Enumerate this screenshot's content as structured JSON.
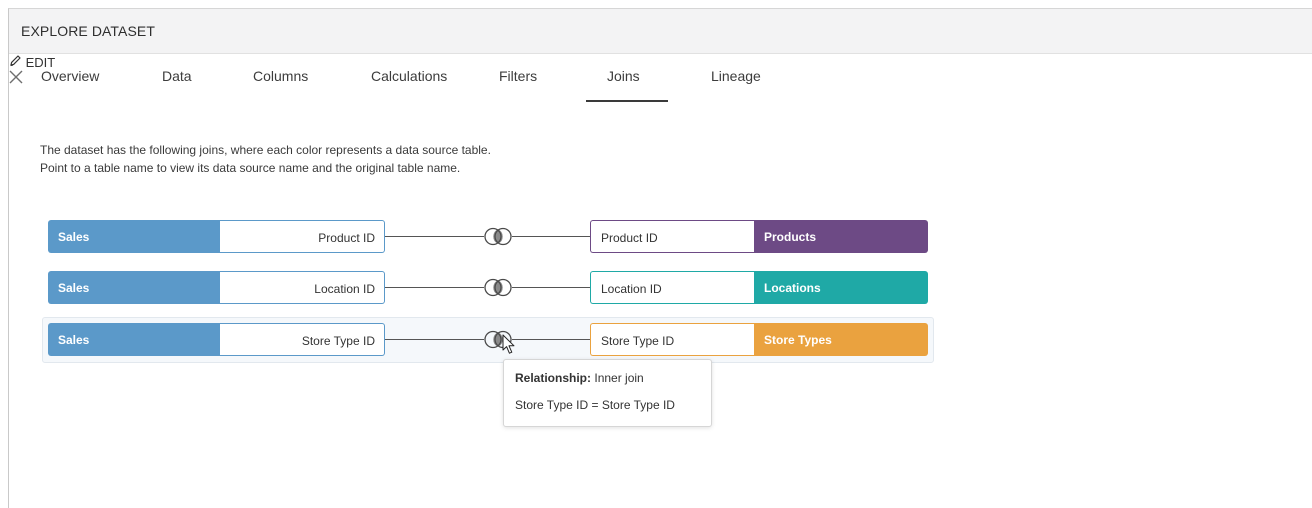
{
  "window": {
    "title": "EXPLORE DATASET",
    "edit_label": "EDIT",
    "edit_icon": "pencil-icon",
    "close_icon": "close-icon"
  },
  "tabs": [
    {
      "label": "Overview",
      "active": false
    },
    {
      "label": "Data",
      "active": false
    },
    {
      "label": "Columns",
      "active": false
    },
    {
      "label": "Calculations",
      "active": false
    },
    {
      "label": "Filters",
      "active": false
    },
    {
      "label": "Joins",
      "active": true
    },
    {
      "label": "Lineage",
      "active": false
    }
  ],
  "description": {
    "line1": "The dataset has the following joins, where each color represents a data source table.",
    "line2": "Point to a table name to view its data source name and the original table name."
  },
  "colors": {
    "sales": "#5b99c9",
    "products": "#6d4a85",
    "locations": "#1fa9a6",
    "store_types": "#eaa23f"
  },
  "joins": [
    {
      "left_table": "Sales",
      "left_column": "Product ID",
      "right_column": "Product ID",
      "right_table": "Products",
      "join_icon": "venn-inner-join-icon"
    },
    {
      "left_table": "Sales",
      "left_column": "Location ID",
      "right_column": "Location ID",
      "right_table": "Locations",
      "join_icon": "venn-inner-join-icon"
    },
    {
      "left_table": "Sales",
      "left_column": "Store Type ID",
      "right_column": "Store Type ID",
      "right_table": "Store Types",
      "join_icon": "venn-inner-join-icon"
    }
  ],
  "tooltip": {
    "relationship_label": "Relationship:",
    "relationship_value": "Inner join",
    "condition": "Store Type ID = Store Type ID"
  }
}
